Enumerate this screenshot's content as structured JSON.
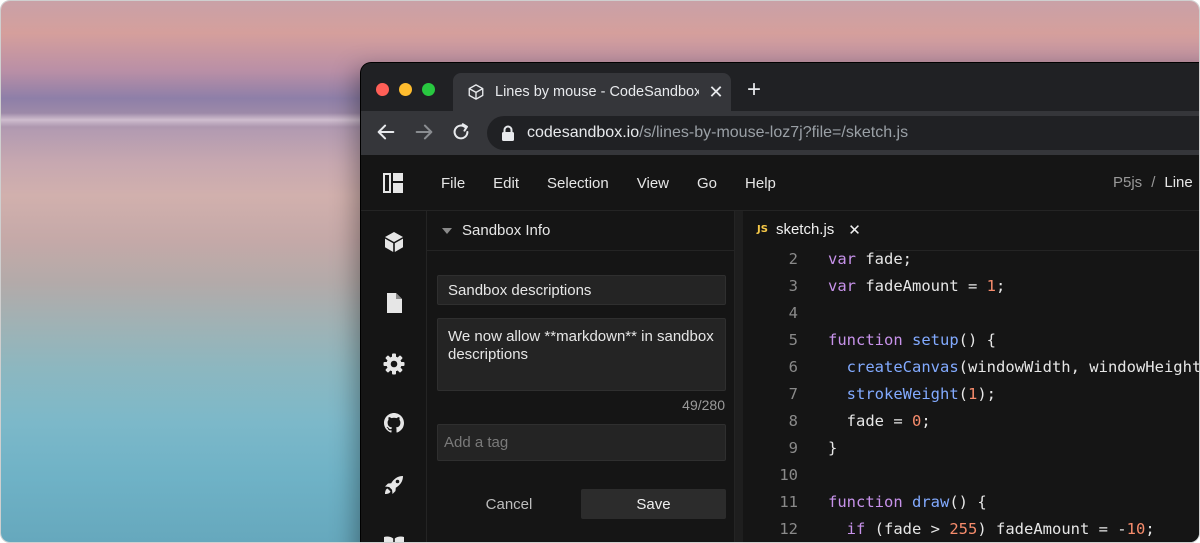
{
  "browser": {
    "tab_title": "Lines by mouse - CodeSandbox",
    "tab_close": "✕",
    "new_tab": "+",
    "url_host": "codesandbox.io",
    "url_path": "/s/lines-by-mouse-loz7j?file=/sketch.js"
  },
  "menu": [
    "File",
    "Edit",
    "Selection",
    "View",
    "Go",
    "Help"
  ],
  "breadcrumb": {
    "parent": "P5js",
    "separator": "/",
    "current": "Line"
  },
  "sidebar": {
    "section_title": "Sandbox Info",
    "title_value": "Sandbox descriptions",
    "description_value": "We now allow **markdown** in sandbox descriptions",
    "char_count": "49/280",
    "tag_placeholder": "Add a tag",
    "cancel_label": "Cancel",
    "save_label": "Save"
  },
  "editor": {
    "tab_badge": "JS",
    "tab_name": "sketch.js",
    "tab_close": "✕",
    "lines": [
      {
        "n": "2",
        "tokens": [
          [
            "kw",
            "var "
          ],
          [
            "plain",
            "fade;"
          ]
        ]
      },
      {
        "n": "3",
        "tokens": [
          [
            "kw",
            "var "
          ],
          [
            "plain",
            "fadeAmount = "
          ],
          [
            "num",
            "1"
          ],
          [
            "plain",
            ";"
          ]
        ]
      },
      {
        "n": "4",
        "tokens": []
      },
      {
        "n": "5",
        "tokens": [
          [
            "kw",
            "function "
          ],
          [
            "fn",
            "setup"
          ],
          [
            "plain",
            "() {"
          ]
        ]
      },
      {
        "n": "6",
        "tokens": [
          [
            "plain",
            "  "
          ],
          [
            "fn",
            "createCanvas"
          ],
          [
            "plain",
            "(windowWidth, windowHeight);"
          ]
        ]
      },
      {
        "n": "7",
        "tokens": [
          [
            "plain",
            "  "
          ],
          [
            "fn",
            "strokeWeight"
          ],
          [
            "plain",
            "("
          ],
          [
            "num",
            "1"
          ],
          [
            "plain",
            ");"
          ]
        ]
      },
      {
        "n": "8",
        "tokens": [
          [
            "plain",
            "  fade = "
          ],
          [
            "num",
            "0"
          ],
          [
            "plain",
            ";"
          ]
        ]
      },
      {
        "n": "9",
        "tokens": [
          [
            "plain",
            "}"
          ]
        ]
      },
      {
        "n": "10",
        "tokens": []
      },
      {
        "n": "11",
        "tokens": [
          [
            "kw",
            "function "
          ],
          [
            "fn",
            "draw"
          ],
          [
            "plain",
            "() {"
          ]
        ]
      },
      {
        "n": "12",
        "tokens": [
          [
            "plain",
            "  "
          ],
          [
            "kw",
            "if "
          ],
          [
            "plain",
            "(fade > "
          ],
          [
            "num",
            "255"
          ],
          [
            "plain",
            ") fadeAmount = -"
          ],
          [
            "num",
            "10"
          ],
          [
            "plain",
            ";"
          ]
        ]
      }
    ]
  },
  "colors": {
    "keyword": "#c792ea",
    "function": "#82aaff",
    "number": "#f78c6c",
    "js_badge": "#f7c948"
  }
}
